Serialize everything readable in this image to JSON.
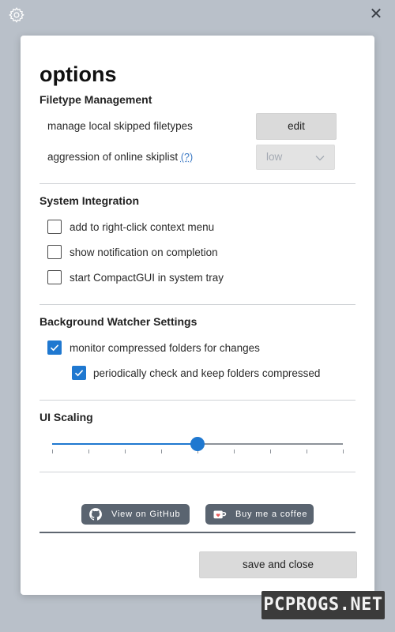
{
  "window": {
    "gear_icon": "gear-icon",
    "close_icon": "close-icon",
    "close_glyph": "✕"
  },
  "options": {
    "title": "options",
    "filetype": {
      "heading": "Filetype Management",
      "manage_label": "manage local skipped filetypes",
      "edit_label": "edit",
      "aggression_label": "aggression of online skiplist",
      "help_link": "(?)",
      "aggression_value": "low"
    },
    "integration": {
      "heading": "System Integration",
      "items": [
        {
          "label": "add to right-click context menu",
          "checked": false
        },
        {
          "label": "show notification on completion",
          "checked": false
        },
        {
          "label": "start CompactGUI in system tray",
          "checked": false
        }
      ]
    },
    "watcher": {
      "heading": "Background Watcher Settings",
      "monitor_label": "monitor compressed folders for changes",
      "monitor_checked": true,
      "periodic_label": "periodically check and keep folders compressed",
      "periodic_checked": true
    },
    "scaling": {
      "heading": "UI Scaling",
      "value_fraction": 0.5,
      "tick_count": 9
    },
    "links": {
      "github_label": "View on GitHub",
      "coffee_label": "Buy me a coffee"
    },
    "save_label": "save and close"
  },
  "colors": {
    "accent": "#1f78d0",
    "pill": "#5a6470",
    "background": "#b9c0c9"
  },
  "watermark": {
    "text": "PCPROGS.NET"
  }
}
